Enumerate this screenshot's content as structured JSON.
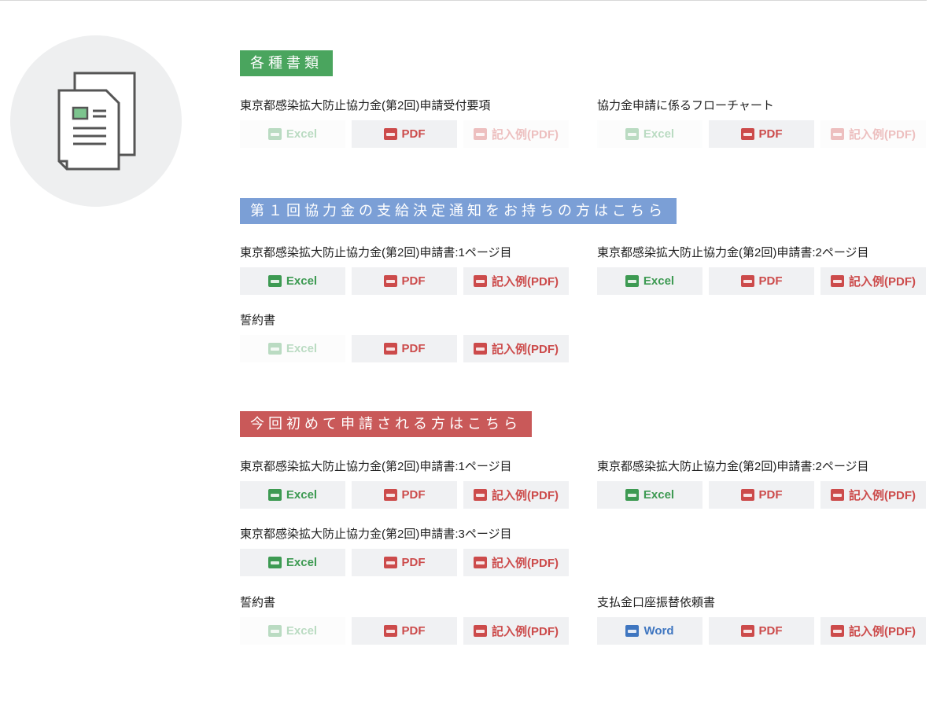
{
  "sections": [
    {
      "title": "各種書類",
      "color": "green",
      "items": [
        {
          "name": "東京都感染拡大防止協力金(第2回)申請受付要項",
          "buttons": [
            {
              "label": "Excel",
              "type": "excel",
              "enabled": false
            },
            {
              "label": "PDF",
              "type": "pdf",
              "enabled": true
            },
            {
              "label": "記入例(PDF)",
              "type": "pdf",
              "enabled": false
            }
          ]
        },
        {
          "name": "協力金申請に係るフローチャート",
          "buttons": [
            {
              "label": "Excel",
              "type": "excel",
              "enabled": false
            },
            {
              "label": "PDF",
              "type": "pdf",
              "enabled": true
            },
            {
              "label": "記入例(PDF)",
              "type": "pdf",
              "enabled": false
            }
          ]
        }
      ]
    },
    {
      "title": "第１回協力金の支給決定通知をお持ちの方はこちら",
      "color": "blue",
      "items": [
        {
          "name": "東京都感染拡大防止協力金(第2回)申請書:1ページ目",
          "buttons": [
            {
              "label": "Excel",
              "type": "excel",
              "enabled": true
            },
            {
              "label": "PDF",
              "type": "pdf",
              "enabled": true
            },
            {
              "label": "記入例(PDF)",
              "type": "pdf",
              "enabled": true
            }
          ]
        },
        {
          "name": "東京都感染拡大防止協力金(第2回)申請書:2ページ目",
          "buttons": [
            {
              "label": "Excel",
              "type": "excel",
              "enabled": true
            },
            {
              "label": "PDF",
              "type": "pdf",
              "enabled": true
            },
            {
              "label": "記入例(PDF)",
              "type": "pdf",
              "enabled": true
            }
          ]
        },
        {
          "name": "誓約書",
          "buttons": [
            {
              "label": "Excel",
              "type": "excel",
              "enabled": false
            },
            {
              "label": "PDF",
              "type": "pdf",
              "enabled": true
            },
            {
              "label": "記入例(PDF)",
              "type": "pdf",
              "enabled": true
            }
          ]
        }
      ]
    },
    {
      "title": "今回初めて申請される方はこちら",
      "color": "red",
      "items": [
        {
          "name": "東京都感染拡大防止協力金(第2回)申請書:1ページ目",
          "buttons": [
            {
              "label": "Excel",
              "type": "excel",
              "enabled": true
            },
            {
              "label": "PDF",
              "type": "pdf",
              "enabled": true
            },
            {
              "label": "記入例(PDF)",
              "type": "pdf",
              "enabled": true
            }
          ]
        },
        {
          "name": "東京都感染拡大防止協力金(第2回)申請書:2ページ目",
          "buttons": [
            {
              "label": "Excel",
              "type": "excel",
              "enabled": true
            },
            {
              "label": "PDF",
              "type": "pdf",
              "enabled": true
            },
            {
              "label": "記入例(PDF)",
              "type": "pdf",
              "enabled": true
            }
          ]
        },
        {
          "name": "東京都感染拡大防止協力金(第2回)申請書:3ページ目",
          "buttons": [
            {
              "label": "Excel",
              "type": "excel",
              "enabled": true
            },
            {
              "label": "PDF",
              "type": "pdf",
              "enabled": true
            },
            {
              "label": "記入例(PDF)",
              "type": "pdf",
              "enabled": true
            }
          ]
        },
        {
          "name": "誓約書",
          "buttons": [
            {
              "label": "Excel",
              "type": "excel",
              "enabled": false
            },
            {
              "label": "PDF",
              "type": "pdf",
              "enabled": true
            },
            {
              "label": "記入例(PDF)",
              "type": "pdf",
              "enabled": true
            }
          ]
        },
        {
          "name": "支払金口座振替依頼書",
          "buttons": [
            {
              "label": "Word",
              "type": "word",
              "enabled": true
            },
            {
              "label": "PDF",
              "type": "pdf",
              "enabled": true
            },
            {
              "label": "記入例(PDF)",
              "type": "pdf",
              "enabled": true
            }
          ]
        }
      ]
    }
  ],
  "icons": {
    "documents": "documents-icon",
    "excel": "excel-file-icon",
    "pdf": "pdf-file-icon",
    "word": "word-file-icon"
  },
  "colors": {
    "green": "#4aa55e",
    "blue": "#7b9fd6",
    "red": "#c95959",
    "excel": "#3d9a52",
    "pdf": "#cc4b4b",
    "word": "#3f76c0"
  }
}
